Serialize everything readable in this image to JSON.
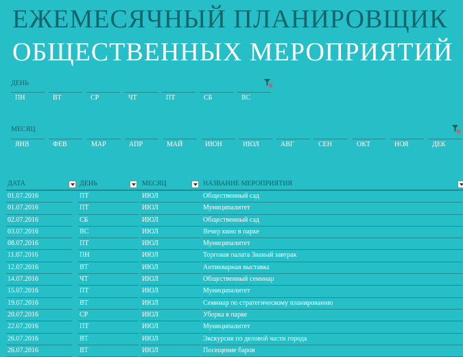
{
  "title": {
    "line1": "ЕЖЕМЕСЯЧНЫЙ ПЛАНИРОВЩИК",
    "line2": "ОБЩЕСТВЕННЫХ МЕРОПРИЯТИЙ"
  },
  "day_slicer": {
    "label": "ДЕНЬ",
    "items": [
      "ПН",
      "ВТ",
      "СР",
      "ЧТ",
      "ПТ",
      "СБ",
      "ВС"
    ]
  },
  "month_slicer": {
    "label": "МЕСЯЦ",
    "items": [
      "ЯНВ",
      "ФЕВ",
      "МАР",
      "АПР",
      "МАЙ",
      "ИЮН",
      "ИЮЛ",
      "АВГ",
      "СЕН",
      "ОКТ",
      "НОЯ",
      "ДЕК"
    ]
  },
  "table": {
    "headers": [
      "ДАТА",
      "ДЕНЬ",
      "МЕСЯЦ",
      "НАЗВАНИЕ МЕРОПРИЯТИЯ"
    ],
    "rows": [
      [
        "01.07.2016",
        "ПТ",
        "ИЮЛ",
        "Общественный сад"
      ],
      [
        "01.07.2016",
        "ПТ",
        "ИЮЛ",
        "Муниципалитет"
      ],
      [
        "02.07.2016",
        "СБ",
        "ИЮЛ",
        "Общественный сад"
      ],
      [
        "03.07.2016",
        "ВС",
        "ИЮЛ",
        "Вечер кино в парке"
      ],
      [
        "08.07.2016",
        "ПТ",
        "ИЮЛ",
        "Муниципалитет"
      ],
      [
        "11.07.2016",
        "ПН",
        "ИЮЛ",
        "Торговая палата Званый завтрак"
      ],
      [
        "12.07.2016",
        "ВТ",
        "ИЮЛ",
        "Антикварная выставка"
      ],
      [
        "14.07.2016",
        "ЧТ",
        "ИЮЛ",
        "Общественный семинар"
      ],
      [
        "15.07.2016",
        "ПТ",
        "ИЮЛ",
        "Муниципалитет"
      ],
      [
        "19.07.2016",
        "ВТ",
        "ИЮЛ",
        "Семинар по стратегическому планированию"
      ],
      [
        "20.07.2016",
        "СР",
        "ИЮЛ",
        "Уборка в парке"
      ],
      [
        "22.07.2016",
        "ПТ",
        "ИЮЛ",
        "Муниципалитет"
      ],
      [
        "26.07.2016",
        "ВТ",
        "ИЮЛ",
        "Экскурсия по деловой части города"
      ],
      [
        "26.07.2016",
        "ВТ",
        "ИЮЛ",
        "Посещение баров"
      ]
    ]
  },
  "colors": {
    "background": "#26bfc7",
    "title_dark": "#15656c",
    "line": "#1f8a92"
  }
}
